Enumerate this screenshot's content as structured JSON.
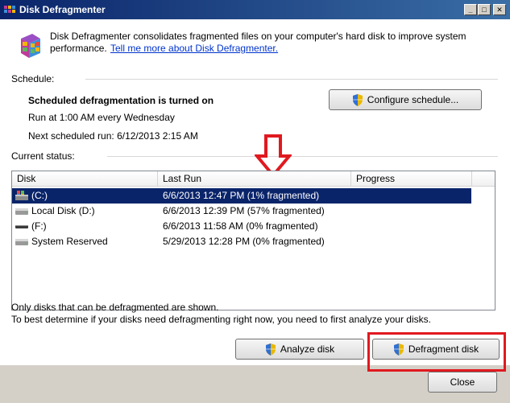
{
  "window": {
    "title": "Disk Defragmenter"
  },
  "intro": {
    "text": "Disk Defragmenter consolidates fragmented files on your computer's hard disk to improve system",
    "text2": "performance.",
    "link": "Tell me more about Disk Defragmenter."
  },
  "schedule": {
    "heading": "Schedule:",
    "status": "Scheduled defragmentation is turned on",
    "run_at": "Run at 1:00 AM every Wednesday",
    "next_run": "Next scheduled run: 6/12/2013 2:15 AM",
    "configure_label": "Configure schedule..."
  },
  "current_status": {
    "heading": "Current status:",
    "columns": [
      "Disk",
      "Last Run",
      "Progress"
    ],
    "rows": [
      {
        "disk": "(C:)",
        "last_run": "6/6/2013 12:47 PM (1% fragmented)",
        "progress": "",
        "icon": "system-drive-icon",
        "selected": true
      },
      {
        "disk": "Local Disk (D:)",
        "last_run": "6/6/2013 12:39 PM (57% fragmented)",
        "progress": "",
        "icon": "hard-drive-icon",
        "selected": false
      },
      {
        "disk": "(F:)",
        "last_run": "6/6/2013 11:58 AM (0% fragmented)",
        "progress": "",
        "icon": "removable-drive-icon",
        "selected": false
      },
      {
        "disk": "System Reserved",
        "last_run": "5/29/2013 12:28 PM (0% fragmented)",
        "progress": "",
        "icon": "hard-drive-icon",
        "selected": false
      }
    ]
  },
  "notes": {
    "line1": "Only disks that can be defragmented are shown.",
    "line2": "To best determine if your disks need defragmenting right now, you need to first analyze your disks."
  },
  "actions": {
    "analyze_label": "Analyze disk",
    "defragment_label": "Defragment disk",
    "close_label": "Close"
  },
  "colors": {
    "annotation": "#e0191f",
    "selection": "#0a246a",
    "link": "#0033cc"
  }
}
